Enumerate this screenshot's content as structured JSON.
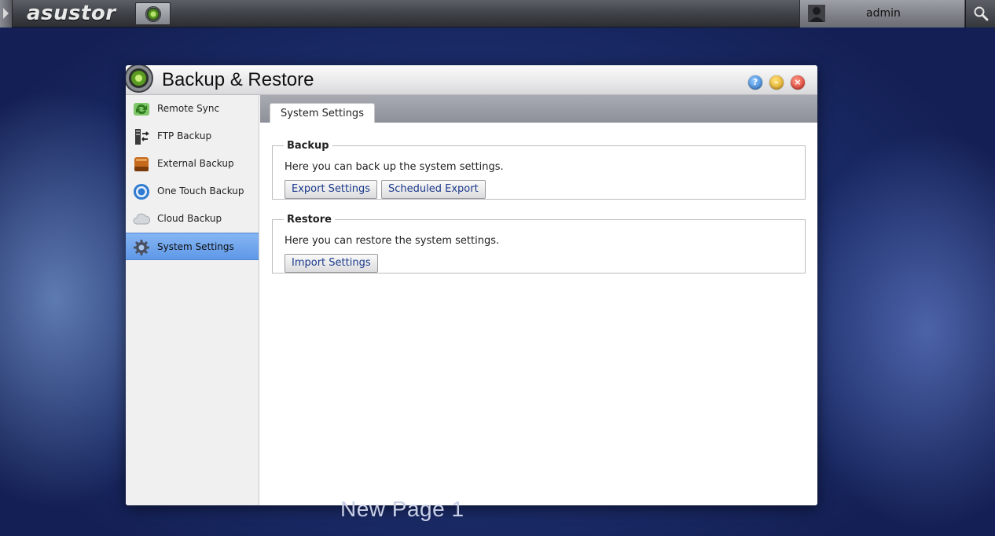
{
  "topbar": {
    "logo_text": "asustor",
    "user_name": "admin"
  },
  "window": {
    "title": "Backup & Restore",
    "controls": {
      "help": "?",
      "minimize": "–",
      "close": "×"
    }
  },
  "sidebar": {
    "items": [
      {
        "label": "Remote Sync",
        "icon": "sync-arrows-icon"
      },
      {
        "label": "FTP Backup",
        "icon": "ftp-transfer-icon"
      },
      {
        "label": "External Backup",
        "icon": "external-drive-icon"
      },
      {
        "label": "One Touch Backup",
        "icon": "one-touch-button-icon"
      },
      {
        "label": "Cloud Backup",
        "icon": "cloud-icon"
      },
      {
        "label": "System Settings",
        "icon": "gear-icon",
        "active": true
      }
    ]
  },
  "content": {
    "tab_label": "System Settings",
    "backup": {
      "legend": "Backup",
      "description": "Here you can back up the system settings.",
      "export_label": "Export Settings",
      "scheduled_label": "Scheduled Export"
    },
    "restore": {
      "legend": "Restore",
      "description": "Here you can restore the system settings.",
      "import_label": "Import Settings"
    }
  },
  "desktop": {
    "page_label": "New Page 1"
  },
  "colors": {
    "accent_blue": "#5f98e8",
    "button_text": "#1c3a8c",
    "desktop_bg": "#1a2a66"
  }
}
